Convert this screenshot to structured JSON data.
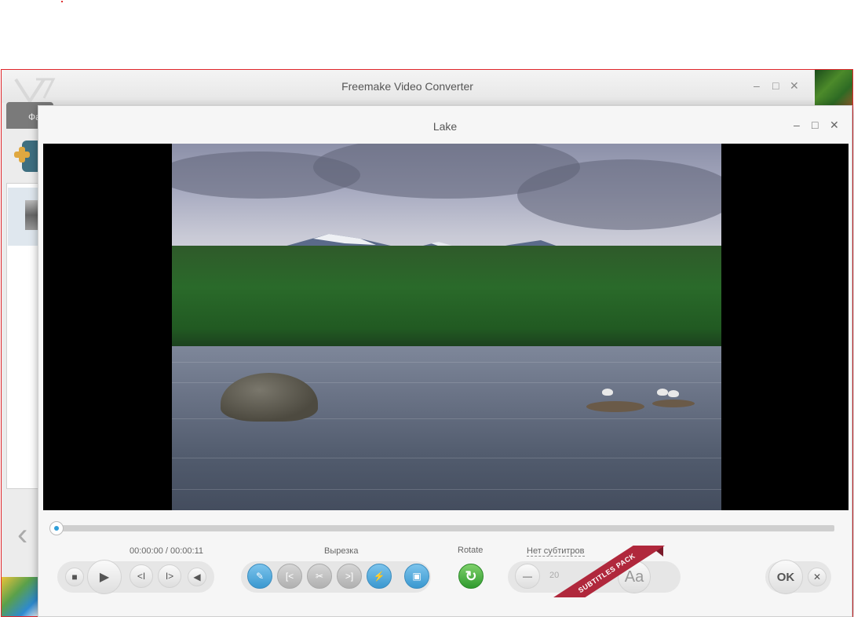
{
  "background_window": {
    "title": "Freemake Video Converter",
    "tab_label": "Фа",
    "controls": {
      "minimize": "–",
      "maximize": "□",
      "close": "✕"
    }
  },
  "dialog": {
    "title": "Lake",
    "controls": {
      "minimize": "–",
      "maximize": "□",
      "close": "✕"
    }
  },
  "player": {
    "time": "00:00:00 / 00:00:11",
    "seek_progress": 0,
    "buttons": {
      "stop": "■",
      "play": "▶",
      "prev_frame": "<I",
      "next_frame": "I>",
      "volume": "◀"
    }
  },
  "cut": {
    "label": "Вырезка",
    "buttons": {
      "select": "✎",
      "mark_in": "[<",
      "cut": "✂",
      "mark_out": ">]",
      "edit": "⚡",
      "preview": "▣"
    }
  },
  "rotate": {
    "label": "Rotate",
    "button": "↻"
  },
  "subtitles": {
    "link": "Нет субтитров",
    "font_size": "20",
    "minus": "—",
    "font_button": "Aa",
    "ribbon": "SUBTITLES PACK"
  },
  "actions": {
    "ok": "OK",
    "close": "✕"
  }
}
